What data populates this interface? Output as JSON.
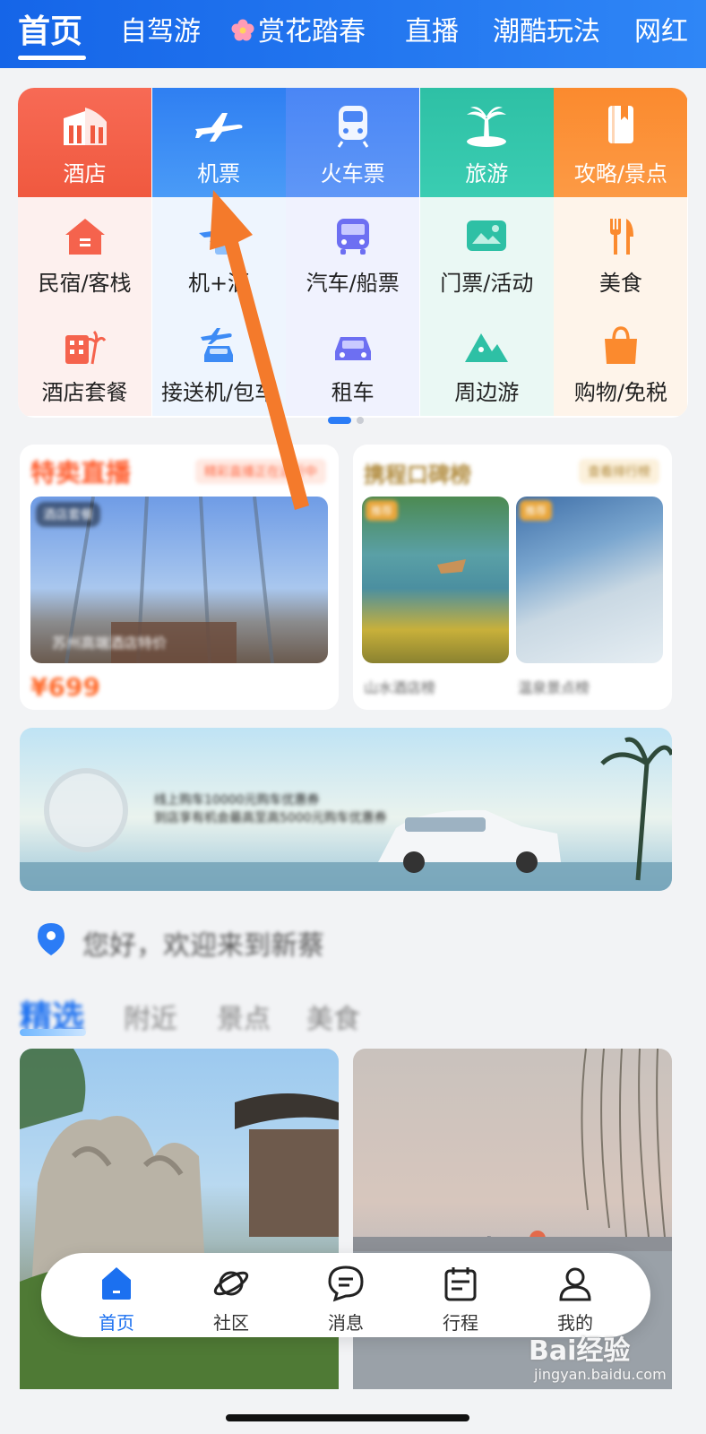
{
  "top_tabs": {
    "items": [
      {
        "label": "首页"
      },
      {
        "label": "自驾游"
      },
      {
        "label": "赏花踏春"
      },
      {
        "label": "直播"
      },
      {
        "label": "潮酷玩法"
      },
      {
        "label": "网红"
      }
    ]
  },
  "primary_grid": [
    {
      "label": "酒店",
      "icon": "hotel-building-icon",
      "color": "#f2654f"
    },
    {
      "label": "机票",
      "icon": "airplane-icon",
      "color": "#3d8bf5"
    },
    {
      "label": "火车票",
      "icon": "train-icon",
      "color": "#4a86f5"
    },
    {
      "label": "旅游",
      "icon": "palm-island-icon",
      "color": "#2ec0a5"
    },
    {
      "label": "攻略/景点",
      "icon": "guidebook-icon",
      "color": "#fb8d32"
    }
  ],
  "secondary_grid": [
    {
      "label": "民宿/客栈",
      "icon": "house-icon"
    },
    {
      "label": "机+酒",
      "icon": "plane-hotel-icon"
    },
    {
      "label": "汽车/船票",
      "icon": "bus-icon"
    },
    {
      "label": "门票/活动",
      "icon": "ticket-icon"
    },
    {
      "label": "美食",
      "icon": "fork-knife-icon"
    },
    {
      "label": "酒店套餐",
      "icon": "hotel-package-icon"
    },
    {
      "label": "接送机/包车",
      "icon": "airport-transfer-icon"
    },
    {
      "label": "租车",
      "icon": "car-rental-icon"
    },
    {
      "label": "周边游",
      "icon": "mountain-icon"
    },
    {
      "label": "购物/免税",
      "icon": "shopping-bag-icon"
    }
  ],
  "promo_cards": {
    "live": {
      "title": "特卖直播",
      "badge": "精彩直播正在进行中",
      "tag": "酒店套餐",
      "caption": "苏州高端酒店特价",
      "price": "¥699"
    },
    "rank": {
      "title": "携程口碑榜",
      "badge": "查看排行榜",
      "tag1": "推荐",
      "tag2": "推荐",
      "cap1": "山水酒店榜",
      "cap2": "温泉景点榜"
    }
  },
  "banner": {
    "line1": "线上购车10000元购车优惠券",
    "line2": "到店享有机会最高至高5000元购车优惠券"
  },
  "welcome": {
    "text": "您好，欢迎来到新蔡"
  },
  "feed_tabs": [
    {
      "label": "精选"
    },
    {
      "label": "附近"
    },
    {
      "label": "景点"
    },
    {
      "label": "美食"
    }
  ],
  "bottom_nav": [
    {
      "label": "首页",
      "icon": "home-icon"
    },
    {
      "label": "社区",
      "icon": "planet-icon"
    },
    {
      "label": "消息",
      "icon": "message-icon"
    },
    {
      "label": "行程",
      "icon": "calendar-icon"
    },
    {
      "label": "我的",
      "icon": "user-icon"
    }
  ],
  "watermark": {
    "brand": "Bai经验",
    "url": "jingyan.baidu.com"
  },
  "colors": {
    "accent": "#1b70f0",
    "arrow": "#f47a2b"
  }
}
